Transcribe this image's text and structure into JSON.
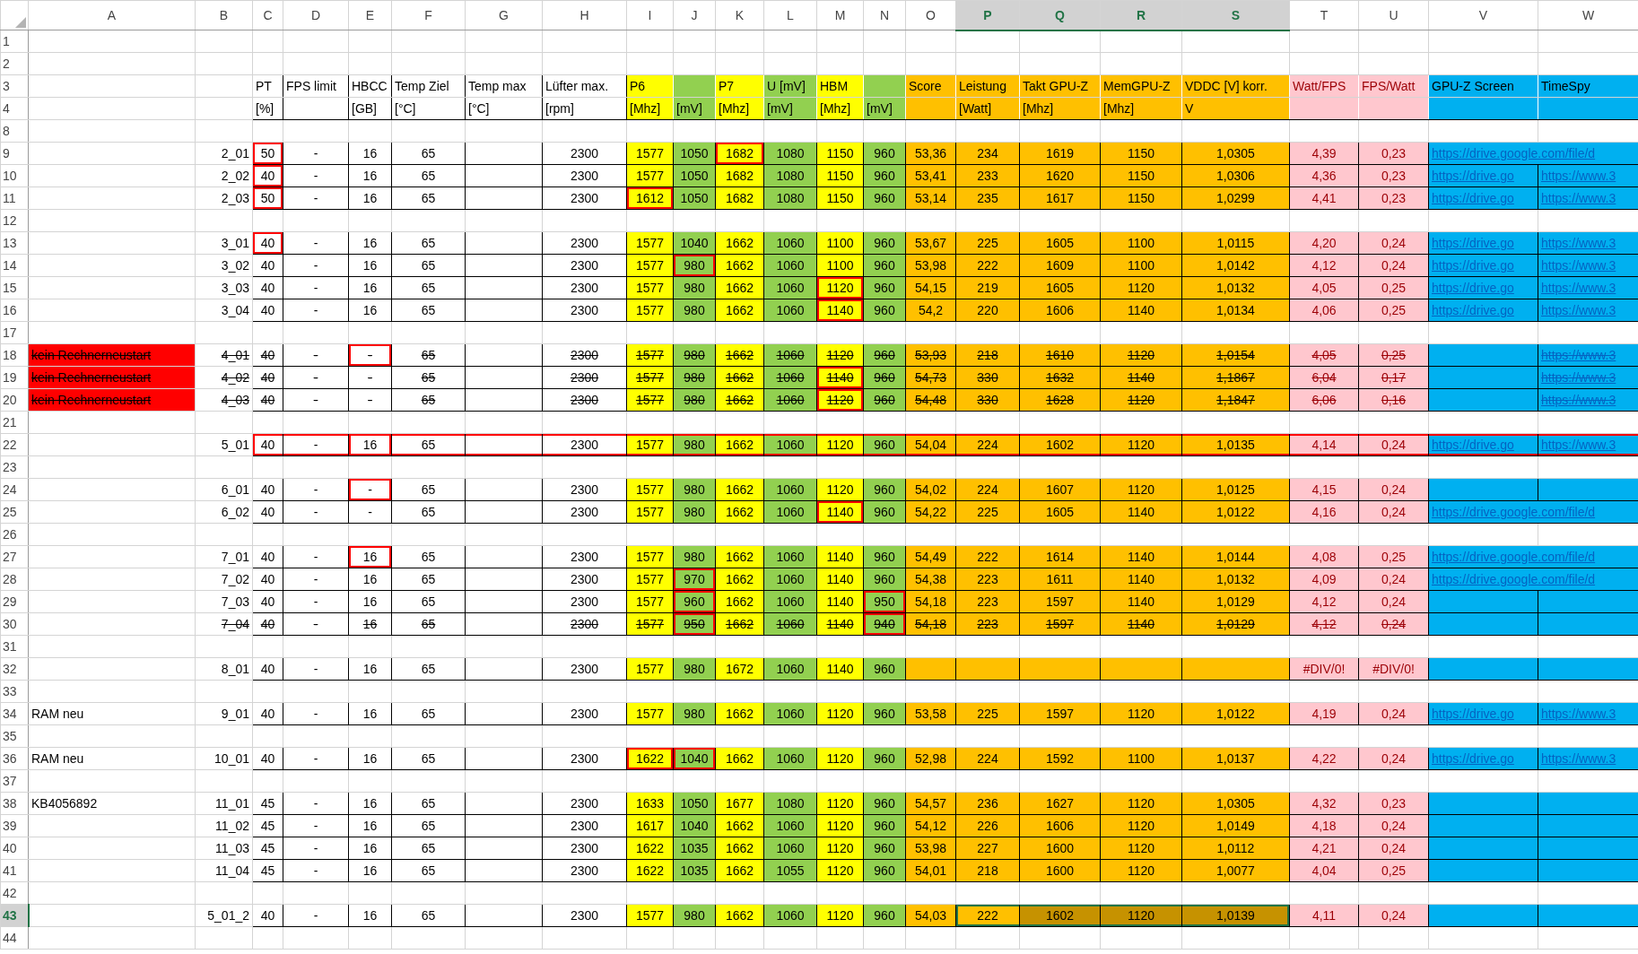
{
  "columns": [
    {
      "label": "A",
      "selected": false
    },
    {
      "label": "B",
      "selected": false
    },
    {
      "label": "C",
      "selected": false
    },
    {
      "label": "D",
      "selected": false
    },
    {
      "label": "E",
      "selected": false
    },
    {
      "label": "F",
      "selected": false
    },
    {
      "label": "G",
      "selected": false
    },
    {
      "label": "H",
      "selected": false
    },
    {
      "label": "I",
      "selected": false
    },
    {
      "label": "J",
      "selected": false
    },
    {
      "label": "K",
      "selected": false
    },
    {
      "label": "L",
      "selected": false
    },
    {
      "label": "M",
      "selected": false
    },
    {
      "label": "N",
      "selected": false
    },
    {
      "label": "O",
      "selected": false
    },
    {
      "label": "P",
      "selected": true
    },
    {
      "label": "Q",
      "selected": true
    },
    {
      "label": "R",
      "selected": true
    },
    {
      "label": "S",
      "selected": true
    },
    {
      "label": "T",
      "selected": false
    },
    {
      "label": "U",
      "selected": false
    },
    {
      "label": "V",
      "selected": false
    },
    {
      "label": "W",
      "selected": false
    }
  ],
  "rows": [
    {
      "number": "1",
      "kind": "blank",
      "selected": false
    },
    {
      "number": "2",
      "kind": "blank",
      "selected": false
    },
    {
      "number": "3",
      "kind": "header",
      "selected": false,
      "cells": {
        "C": "PT",
        "D": "FPS limit",
        "E": "HBCC",
        "F": "Temp Ziel",
        "G": "Temp max",
        "H": "Lüfter max.",
        "I": "P6",
        "K": "P7",
        "L": "U [mV]",
        "M": "HBM",
        "O": "Score",
        "P": "Leistung",
        "Q": "Takt GPU-Z",
        "R": "MemGPU-Z",
        "S": "VDDC [V] korr.",
        "T": "Watt/FPS",
        "U": "FPS/Watt",
        "V": "GPU-Z Screen",
        "W": "TimeSpy"
      }
    },
    {
      "number": "4",
      "kind": "header",
      "selected": false,
      "cells": {
        "C": "[%]",
        "E": "[GB]",
        "F": "[°C]",
        "G": "[°C]",
        "H": "[rpm]",
        "I": "[Mhz]",
        "J": "[mV]",
        "K": "[Mhz]",
        "L": "[mV]",
        "M": "[Mhz]",
        "N": "[mV]",
        "P": "[Watt]",
        "Q": "[Mhz]",
        "R": "[Mhz]",
        "S": "V"
      }
    },
    {
      "number": "8",
      "kind": "blank",
      "selected": false
    },
    {
      "number": "9",
      "kind": "data",
      "selected": false,
      "struck": false,
      "flagged": {
        "C": true,
        "K": true
      },
      "cells": {
        "B": "2_01",
        "C": "50",
        "D": "-",
        "E": "16",
        "F": "65",
        "H": "2300",
        "I": "1577",
        "J": "1050",
        "K": "1682",
        "L": "1080",
        "M": "1150",
        "N": "960",
        "O": "53,36",
        "P": "234",
        "Q": "1619",
        "R": "1150",
        "S": "1,0305",
        "T": "4,39",
        "U": "0,23",
        "V": "https://drive.google.com/file/d"
      }
    },
    {
      "number": "10",
      "kind": "data",
      "selected": false,
      "struck": false,
      "flagged": {
        "C": true
      },
      "cells": {
        "B": "2_02",
        "C": "40",
        "D": "-",
        "E": "16",
        "F": "65",
        "H": "2300",
        "I": "1577",
        "J": "1050",
        "K": "1682",
        "L": "1080",
        "M": "1150",
        "N": "960",
        "O": "53,41",
        "P": "233",
        "Q": "1620",
        "R": "1150",
        "S": "1,0306",
        "T": "4,36",
        "U": "0,23",
        "V": "https://drive.go",
        "W": "https://www.3"
      }
    },
    {
      "number": "11",
      "kind": "data",
      "selected": false,
      "struck": false,
      "flagged": {
        "C": true,
        "I": true
      },
      "cells": {
        "B": "2_03",
        "C": "50",
        "D": "-",
        "E": "16",
        "F": "65",
        "H": "2300",
        "I": "1612",
        "J": "1050",
        "K": "1682",
        "L": "1080",
        "M": "1150",
        "N": "960",
        "O": "53,14",
        "P": "235",
        "Q": "1617",
        "R": "1150",
        "S": "1,0299",
        "T": "4,41",
        "U": "0,23",
        "V": "https://drive.go",
        "W": "https://www.3"
      }
    },
    {
      "number": "12",
      "kind": "blank",
      "selected": false
    },
    {
      "number": "13",
      "kind": "data",
      "selected": false,
      "struck": false,
      "flagged": {
        "C": true
      },
      "cells": {
        "B": "3_01",
        "C": "40",
        "D": "-",
        "E": "16",
        "F": "65",
        "H": "2300",
        "I": "1577",
        "J": "1040",
        "K": "1662",
        "L": "1060",
        "M": "1100",
        "N": "960",
        "O": "53,67",
        "P": "225",
        "Q": "1605",
        "R": "1100",
        "S": "1,0115",
        "T": "4,20",
        "U": "0,24",
        "V": "https://drive.go",
        "W": "https://www.3"
      }
    },
    {
      "number": "14",
      "kind": "data",
      "selected": false,
      "struck": false,
      "flagged": {
        "J": true
      },
      "cells": {
        "B": "3_02",
        "C": "40",
        "D": "-",
        "E": "16",
        "F": "65",
        "H": "2300",
        "I": "1577",
        "J": "980",
        "K": "1662",
        "L": "1060",
        "M": "1100",
        "N": "960",
        "O": "53,98",
        "P": "222",
        "Q": "1609",
        "R": "1100",
        "S": "1,0142",
        "T": "4,12",
        "U": "0,24",
        "V": "https://drive.go",
        "W": "https://www.3"
      }
    },
    {
      "number": "15",
      "kind": "data",
      "selected": false,
      "struck": false,
      "flagged": {
        "M": true
      },
      "cells": {
        "B": "3_03",
        "C": "40",
        "D": "-",
        "E": "16",
        "F": "65",
        "H": "2300",
        "I": "1577",
        "J": "980",
        "K": "1662",
        "L": "1060",
        "M": "1120",
        "N": "960",
        "O": "54,15",
        "P": "219",
        "Q": "1605",
        "R": "1120",
        "S": "1,0132",
        "T": "4,05",
        "U": "0,25",
        "V": "https://drive.go",
        "W": "https://www.3"
      }
    },
    {
      "number": "16",
      "kind": "data",
      "selected": false,
      "struck": false,
      "flagged": {
        "M": true
      },
      "cells": {
        "B": "3_04",
        "C": "40",
        "D": "-",
        "E": "16",
        "F": "65",
        "H": "2300",
        "I": "1577",
        "J": "980",
        "K": "1662",
        "L": "1060",
        "M": "1140",
        "N": "960",
        "O": "54,2",
        "P": "220",
        "Q": "1606",
        "R": "1140",
        "S": "1,0134",
        "T": "4,06",
        "U": "0,25",
        "V": "https://drive.go",
        "W": "https://www.3"
      }
    },
    {
      "number": "17",
      "kind": "blank",
      "selected": false
    },
    {
      "number": "18",
      "kind": "data",
      "selected": false,
      "struck": true,
      "alert": true,
      "flagged": {
        "E": true
      },
      "cells": {
        "A": "kein Rechnerneustart",
        "B": "4_01",
        "C": "40",
        "D": "-",
        "E": "-",
        "F": "65",
        "H": "2300",
        "I": "1577",
        "J": "980",
        "K": "1662",
        "L": "1060",
        "M": "1120",
        "N": "960",
        "O": "53,93",
        "P": "218",
        "Q": "1610",
        "R": "1120",
        "S": "1,0154",
        "T": "4,05",
        "U": "0,25",
        "W": "https://www.3"
      }
    },
    {
      "number": "19",
      "kind": "data",
      "selected": false,
      "struck": true,
      "alert": true,
      "flagged": {
        "M": true
      },
      "cells": {
        "A": "kein Rechnerneustart",
        "B": "4_02",
        "C": "40",
        "D": "-",
        "E": "-",
        "F": "65",
        "H": "2300",
        "I": "1577",
        "J": "980",
        "K": "1662",
        "L": "1060",
        "M": "1140",
        "N": "960",
        "O": "54,73",
        "P": "330",
        "Q": "1632",
        "R": "1140",
        "S": "1,1867",
        "T": "6,04",
        "U": "0,17",
        "W": "https://www.3"
      }
    },
    {
      "number": "20",
      "kind": "data",
      "selected": false,
      "struck": true,
      "alert": true,
      "flagged": {
        "M": true
      },
      "cells": {
        "A": "kein Rechnerneustart",
        "B": "4_03",
        "C": "40",
        "D": "-",
        "E": "-",
        "F": "65",
        "H": "2300",
        "I": "1577",
        "J": "980",
        "K": "1662",
        "L": "1060",
        "M": "1120",
        "N": "960",
        "O": "54,48",
        "P": "330",
        "Q": "1628",
        "R": "1120",
        "S": "1,1847",
        "T": "6,06",
        "U": "0,16",
        "W": "https://www.3"
      }
    },
    {
      "number": "21",
      "kind": "blank",
      "selected": false
    },
    {
      "number": "22",
      "kind": "data",
      "selected": false,
      "struck": false,
      "outlined": true,
      "flagged": {
        "E": true
      },
      "cells": {
        "B": "5_01",
        "C": "40",
        "D": "-",
        "E": "16",
        "F": "65",
        "H": "2300",
        "I": "1577",
        "J": "980",
        "K": "1662",
        "L": "1060",
        "M": "1120",
        "N": "960",
        "O": "54,04",
        "P": "224",
        "Q": "1602",
        "R": "1120",
        "S": "1,0135",
        "T": "4,14",
        "U": "0,24",
        "V": "https://drive.go",
        "W": "https://www.3"
      }
    },
    {
      "number": "23",
      "kind": "blank",
      "selected": false
    },
    {
      "number": "24",
      "kind": "data",
      "selected": false,
      "struck": false,
      "flagged": {
        "E": true
      },
      "cells": {
        "B": "6_01",
        "C": "40",
        "D": "-",
        "E": "-",
        "F": "65",
        "H": "2300",
        "I": "1577",
        "J": "980",
        "K": "1662",
        "L": "1060",
        "M": "1120",
        "N": "960",
        "O": "54,02",
        "P": "224",
        "Q": "1607",
        "R": "1120",
        "S": "1,0125",
        "T": "4,15",
        "U": "0,24"
      }
    },
    {
      "number": "25",
      "kind": "data",
      "selected": false,
      "struck": false,
      "flagged": {
        "M": true
      },
      "cells": {
        "B": "6_02",
        "C": "40",
        "D": "-",
        "E": "-",
        "F": "65",
        "H": "2300",
        "I": "1577",
        "J": "980",
        "K": "1662",
        "L": "1060",
        "M": "1140",
        "N": "960",
        "O": "54,22",
        "P": "225",
        "Q": "1605",
        "R": "1140",
        "S": "1,0122",
        "T": "4,16",
        "U": "0,24",
        "V": "https://drive.google.com/file/d"
      }
    },
    {
      "number": "26",
      "kind": "blank",
      "selected": false
    },
    {
      "number": "27",
      "kind": "data",
      "selected": false,
      "struck": false,
      "flagged": {
        "E": true
      },
      "cells": {
        "B": "7_01",
        "C": "40",
        "D": "-",
        "E": "16",
        "F": "65",
        "H": "2300",
        "I": "1577",
        "J": "980",
        "K": "1662",
        "L": "1060",
        "M": "1140",
        "N": "960",
        "O": "54,49",
        "P": "222",
        "Q": "1614",
        "R": "1140",
        "S": "1,0144",
        "T": "4,08",
        "U": "0,25",
        "V": "https://drive.google.com/file/d"
      }
    },
    {
      "number": "28",
      "kind": "data",
      "selected": false,
      "struck": false,
      "flagged": {
        "J": true
      },
      "cells": {
        "B": "7_02",
        "C": "40",
        "D": "-",
        "E": "16",
        "F": "65",
        "H": "2300",
        "I": "1577",
        "J": "970",
        "K": "1662",
        "L": "1060",
        "M": "1140",
        "N": "960",
        "O": "54,38",
        "P": "223",
        "Q": "1611",
        "R": "1140",
        "S": "1,0132",
        "T": "4,09",
        "U": "0,24",
        "V": "https://drive.google.com/file/d"
      }
    },
    {
      "number": "29",
      "kind": "data",
      "selected": false,
      "struck": false,
      "flagged": {
        "J": true,
        "N": true
      },
      "cells": {
        "B": "7_03",
        "C": "40",
        "D": "-",
        "E": "16",
        "F": "65",
        "H": "2300",
        "I": "1577",
        "J": "960",
        "K": "1662",
        "L": "1060",
        "M": "1140",
        "N": "950",
        "O": "54,18",
        "P": "223",
        "Q": "1597",
        "R": "1140",
        "S": "1,0129",
        "T": "4,12",
        "U": "0,24"
      }
    },
    {
      "number": "30",
      "kind": "data",
      "selected": false,
      "struck": true,
      "flagged": {
        "J": true,
        "N": true
      },
      "cells": {
        "B": "7_04",
        "C": "40",
        "D": "-",
        "E": "16",
        "F": "65",
        "H": "2300",
        "I": "1577",
        "J": "950",
        "K": "1662",
        "L": "1060",
        "M": "1140",
        "N": "940",
        "O": "54,18",
        "P": "223",
        "Q": "1597",
        "R": "1140",
        "S": "1,0129",
        "T": "4,12",
        "U": "0,24"
      }
    },
    {
      "number": "31",
      "kind": "blank",
      "selected": false
    },
    {
      "number": "32",
      "kind": "data",
      "selected": false,
      "struck": false,
      "cells": {
        "B": "8_01",
        "C": "40",
        "D": "-",
        "E": "16",
        "F": "65",
        "H": "2300",
        "I": "1577",
        "J": "980",
        "K": "1672",
        "L": "1060",
        "M": "1140",
        "N": "960",
        "T": "#DIV/0!",
        "U": "#DIV/0!"
      }
    },
    {
      "number": "33",
      "kind": "blank",
      "selected": false
    },
    {
      "number": "34",
      "kind": "data",
      "selected": false,
      "struck": false,
      "cells": {
        "A": "RAM neu",
        "B": "9_01",
        "C": "40",
        "D": "-",
        "E": "16",
        "F": "65",
        "H": "2300",
        "I": "1577",
        "J": "980",
        "K": "1662",
        "L": "1060",
        "M": "1120",
        "N": "960",
        "O": "53,58",
        "P": "225",
        "Q": "1597",
        "R": "1120",
        "S": "1,0122",
        "T": "4,19",
        "U": "0,24",
        "V": "https://drive.go",
        "W": "https://www.3"
      }
    },
    {
      "number": "35",
      "kind": "blank",
      "selected": false
    },
    {
      "number": "36",
      "kind": "data",
      "selected": false,
      "struck": false,
      "flagged": {
        "I": true,
        "J": true
      },
      "cells": {
        "A": "RAM neu",
        "B": "10_01",
        "C": "40",
        "D": "-",
        "E": "16",
        "F": "65",
        "H": "2300",
        "I": "1622",
        "J": "1040",
        "K": "1662",
        "L": "1060",
        "M": "1120",
        "N": "960",
        "O": "52,98",
        "P": "224",
        "Q": "1592",
        "R": "1100",
        "S": "1,0137",
        "T": "4,22",
        "U": "0,24",
        "V": "https://drive.go",
        "W": "https://www.3"
      }
    },
    {
      "number": "37",
      "kind": "blank",
      "selected": false
    },
    {
      "number": "38",
      "kind": "data",
      "selected": false,
      "struck": false,
      "cells": {
        "A": "KB4056892",
        "B": "11_01",
        "C": "45",
        "D": "-",
        "E": "16",
        "F": "65",
        "H": "2300",
        "I": "1633",
        "J": "1050",
        "K": "1677",
        "L": "1080",
        "M": "1120",
        "N": "960",
        "O": "54,57",
        "P": "236",
        "Q": "1627",
        "R": "1120",
        "S": "1,0305",
        "T": "4,32",
        "U": "0,23"
      }
    },
    {
      "number": "39",
      "kind": "data",
      "selected": false,
      "struck": false,
      "cells": {
        "B": "11_02",
        "C": "45",
        "D": "-",
        "E": "16",
        "F": "65",
        "H": "2300",
        "I": "1617",
        "J": "1040",
        "K": "1662",
        "L": "1060",
        "M": "1120",
        "N": "960",
        "O": "54,12",
        "P": "226",
        "Q": "1606",
        "R": "1120",
        "S": "1,0149",
        "T": "4,18",
        "U": "0,24"
      }
    },
    {
      "number": "40",
      "kind": "data",
      "selected": false,
      "struck": false,
      "cells": {
        "B": "11_03",
        "C": "45",
        "D": "-",
        "E": "16",
        "F": "65",
        "H": "2300",
        "I": "1622",
        "J": "1035",
        "K": "1662",
        "L": "1060",
        "M": "1120",
        "N": "960",
        "O": "53,98",
        "P": "227",
        "Q": "1600",
        "R": "1120",
        "S": "1,0112",
        "T": "4,21",
        "U": "0,24"
      }
    },
    {
      "number": "41",
      "kind": "data",
      "selected": false,
      "struck": false,
      "cells": {
        "B": "11_04",
        "C": "45",
        "D": "-",
        "E": "16",
        "F": "65",
        "H": "2300",
        "I": "1622",
        "J": "1035",
        "K": "1662",
        "L": "1055",
        "M": "1120",
        "N": "960",
        "O": "54,01",
        "P": "218",
        "Q": "1600",
        "R": "1120",
        "S": "1,0077",
        "T": "4,04",
        "U": "0,25"
      }
    },
    {
      "number": "42",
      "kind": "blank",
      "selected": false
    },
    {
      "number": "43",
      "kind": "data",
      "selected": true,
      "struck": false,
      "selected_cells": {
        "P": true,
        "Q": true,
        "R": true,
        "S": true
      },
      "cells": {
        "B": "5_01_2",
        "C": "40",
        "D": "-",
        "E": "16",
        "F": "65",
        "H": "2300",
        "I": "1577",
        "J": "980",
        "K": "1662",
        "L": "1060",
        "M": "1120",
        "N": "960",
        "O": "54,03",
        "P": "222",
        "Q": "1602",
        "R": "1120",
        "S": "1,0139",
        "T": "4,11",
        "U": "0,24"
      }
    },
    {
      "number": "44",
      "kind": "blank",
      "selected": false
    }
  ]
}
